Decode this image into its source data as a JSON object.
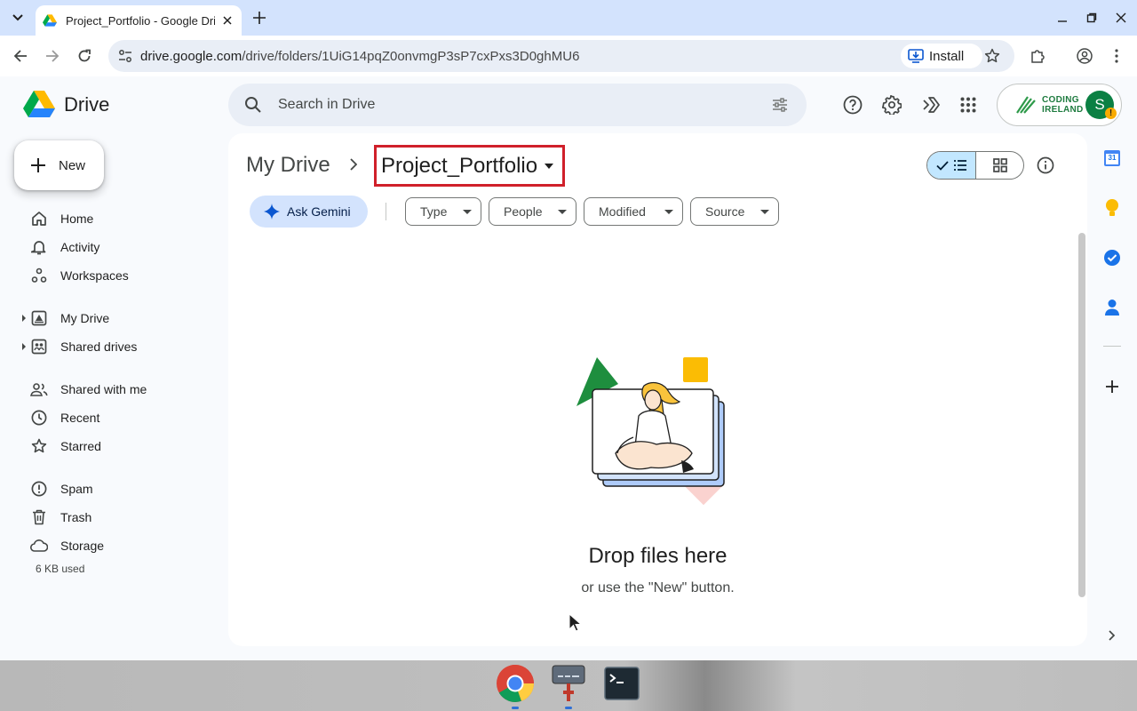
{
  "browser": {
    "tab_title": "Project_Portfolio - Google Drive",
    "url_domain": "drive.google.com",
    "url_path": "/drive/folders/1UiG14pqZ0onvmgP3sP7cxPxs3D0ghMU6",
    "install_label": "Install"
  },
  "drive": {
    "logo_text": "Drive",
    "search_placeholder": "Search in Drive",
    "account": {
      "org_line1": "CODING",
      "org_line2": "IRELAND",
      "avatar_letter": "S",
      "badge": "!"
    }
  },
  "sidebar": {
    "new_label": "New",
    "items": [
      {
        "label": "Home",
        "icon": "home-icon"
      },
      {
        "label": "Activity",
        "icon": "bell-icon"
      },
      {
        "label": "Workspaces",
        "icon": "workspaces-icon"
      },
      {
        "label": "My Drive",
        "icon": "my-drive-icon"
      },
      {
        "label": "Shared drives",
        "icon": "shared-drives-icon"
      },
      {
        "label": "Shared with me",
        "icon": "people-icon"
      },
      {
        "label": "Recent",
        "icon": "clock-icon"
      },
      {
        "label": "Starred",
        "icon": "star-icon"
      },
      {
        "label": "Spam",
        "icon": "spam-icon"
      },
      {
        "label": "Trash",
        "icon": "trash-icon"
      },
      {
        "label": "Storage",
        "icon": "cloud-icon"
      }
    ],
    "storage_used": "6 KB used"
  },
  "main": {
    "breadcrumb_root": "My Drive",
    "breadcrumb_current": "Project_Portfolio",
    "gemini_label": "Ask Gemini",
    "filters": [
      "Type",
      "People",
      "Modified",
      "Source"
    ],
    "empty_title": "Drop files here",
    "empty_subtitle": "or use the \"New\" button."
  },
  "side_panel": {
    "calendar_day": "31"
  },
  "colors": {
    "accent_blue": "#0b57d0",
    "highlight_red": "#d0202a",
    "selected_toggle": "#c2e7ff"
  }
}
